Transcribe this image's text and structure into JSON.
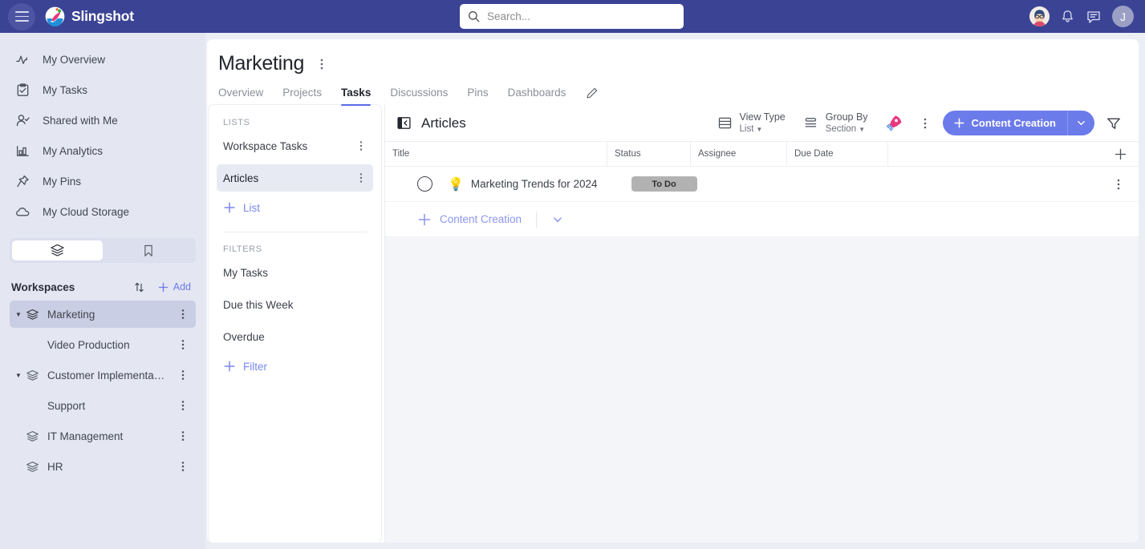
{
  "topbar": {
    "menu_icon": "hamburger-icon",
    "brand": "Slingshot",
    "search_placeholder": "Search...",
    "search_value": "",
    "search_icon": "search-icon",
    "notification_icon": "bell-icon",
    "messages_icon": "chat-icon",
    "user_initial": "J",
    "avatar_icon": "user-avatar"
  },
  "sidebar": {
    "nav": [
      {
        "label": "My Overview",
        "icon": "activity-icon"
      },
      {
        "label": "My Tasks",
        "icon": "clipboard-check-icon"
      },
      {
        "label": "Shared with Me",
        "icon": "person-check-icon"
      },
      {
        "label": "My Analytics",
        "icon": "bar-chart-icon"
      },
      {
        "label": "My Pins",
        "icon": "pin-icon"
      },
      {
        "label": "My Cloud Storage",
        "icon": "cloud-icon"
      }
    ],
    "segmented": [
      {
        "icon": "layers-icon",
        "active": true
      },
      {
        "icon": "bookmark-icon",
        "active": false
      }
    ],
    "workspaces_title": "Workspaces",
    "sort_icon": "sort-arrows-icon",
    "add_label": "Add",
    "add_icon": "plus-icon",
    "workspaces": [
      {
        "label": "Marketing",
        "child": false,
        "expanded": true,
        "selected": true,
        "icon": "layers-icon"
      },
      {
        "label": "Video Production",
        "child": true,
        "expanded": false,
        "selected": false,
        "icon": ""
      },
      {
        "label": "Customer Implementa…",
        "child": false,
        "expanded": true,
        "selected": false,
        "icon": "layers-icon"
      },
      {
        "label": "Support",
        "child": true,
        "expanded": false,
        "selected": false,
        "icon": ""
      },
      {
        "label": "IT Management",
        "child": false,
        "expanded": false,
        "selected": false,
        "icon": "layers-icon"
      },
      {
        "label": "HR",
        "child": false,
        "expanded": false,
        "selected": false,
        "icon": "layers-icon"
      }
    ]
  },
  "page": {
    "title": "Marketing",
    "menu_icon": "more-vertical-icon",
    "edit_icon": "pencil-icon",
    "tabs": [
      {
        "label": "Overview",
        "active": false
      },
      {
        "label": "Projects",
        "active": false
      },
      {
        "label": "Tasks",
        "active": true
      },
      {
        "label": "Discussions",
        "active": false
      },
      {
        "label": "Pins",
        "active": false
      },
      {
        "label": "Dashboards",
        "active": false
      }
    ]
  },
  "lists_panel": {
    "lists_header": "LISTS",
    "lists": [
      {
        "label": "Workspace Tasks",
        "selected": false
      },
      {
        "label": "Articles",
        "selected": true
      }
    ],
    "add_list_label": "List",
    "filters_header": "FILTERS",
    "filters": [
      {
        "label": "My Tasks"
      },
      {
        "label": "Due this Week"
      },
      {
        "label": "Overdue"
      }
    ],
    "add_filter_label": "Filter"
  },
  "table": {
    "collapse_icon": "collapse-panel-icon",
    "title": "Articles",
    "view_type_label": "View Type",
    "view_type_value": "List",
    "view_type_icon": "list-view-icon",
    "group_by_label": "Group By",
    "group_by_value": "Section",
    "group_by_icon": "group-by-icon",
    "rocket_icon": "rocket-icon",
    "more_icon": "more-vertical-icon",
    "cta_label": "Content Creation",
    "cta_icon": "plus-icon",
    "cta_chevron_icon": "chevron-down-icon",
    "filter_icon": "funnel-icon",
    "columns": [
      "Title",
      "Status",
      "Assignee",
      "Due Date"
    ],
    "add_column_icon": "plus-icon",
    "rows": [
      {
        "emoji": "💡",
        "title": "Marketing Trends for 2024",
        "status": "To Do",
        "status_color": "#b2b2b2",
        "assignee": "",
        "due_date": "",
        "row_menu_icon": "more-vertical-icon"
      }
    ],
    "group_add_label": "Content Creation",
    "group_add_icon": "plus-icon",
    "group_chevron_icon": "chevron-down-icon"
  },
  "colors": {
    "brand_bar": "#3b4395",
    "accent": "#6c7bea",
    "sidebar_bg": "#e4e7f2",
    "selected_ws": "#c9cee4",
    "status_todo": "#b2b2b2",
    "rocket": "#e8377d"
  }
}
